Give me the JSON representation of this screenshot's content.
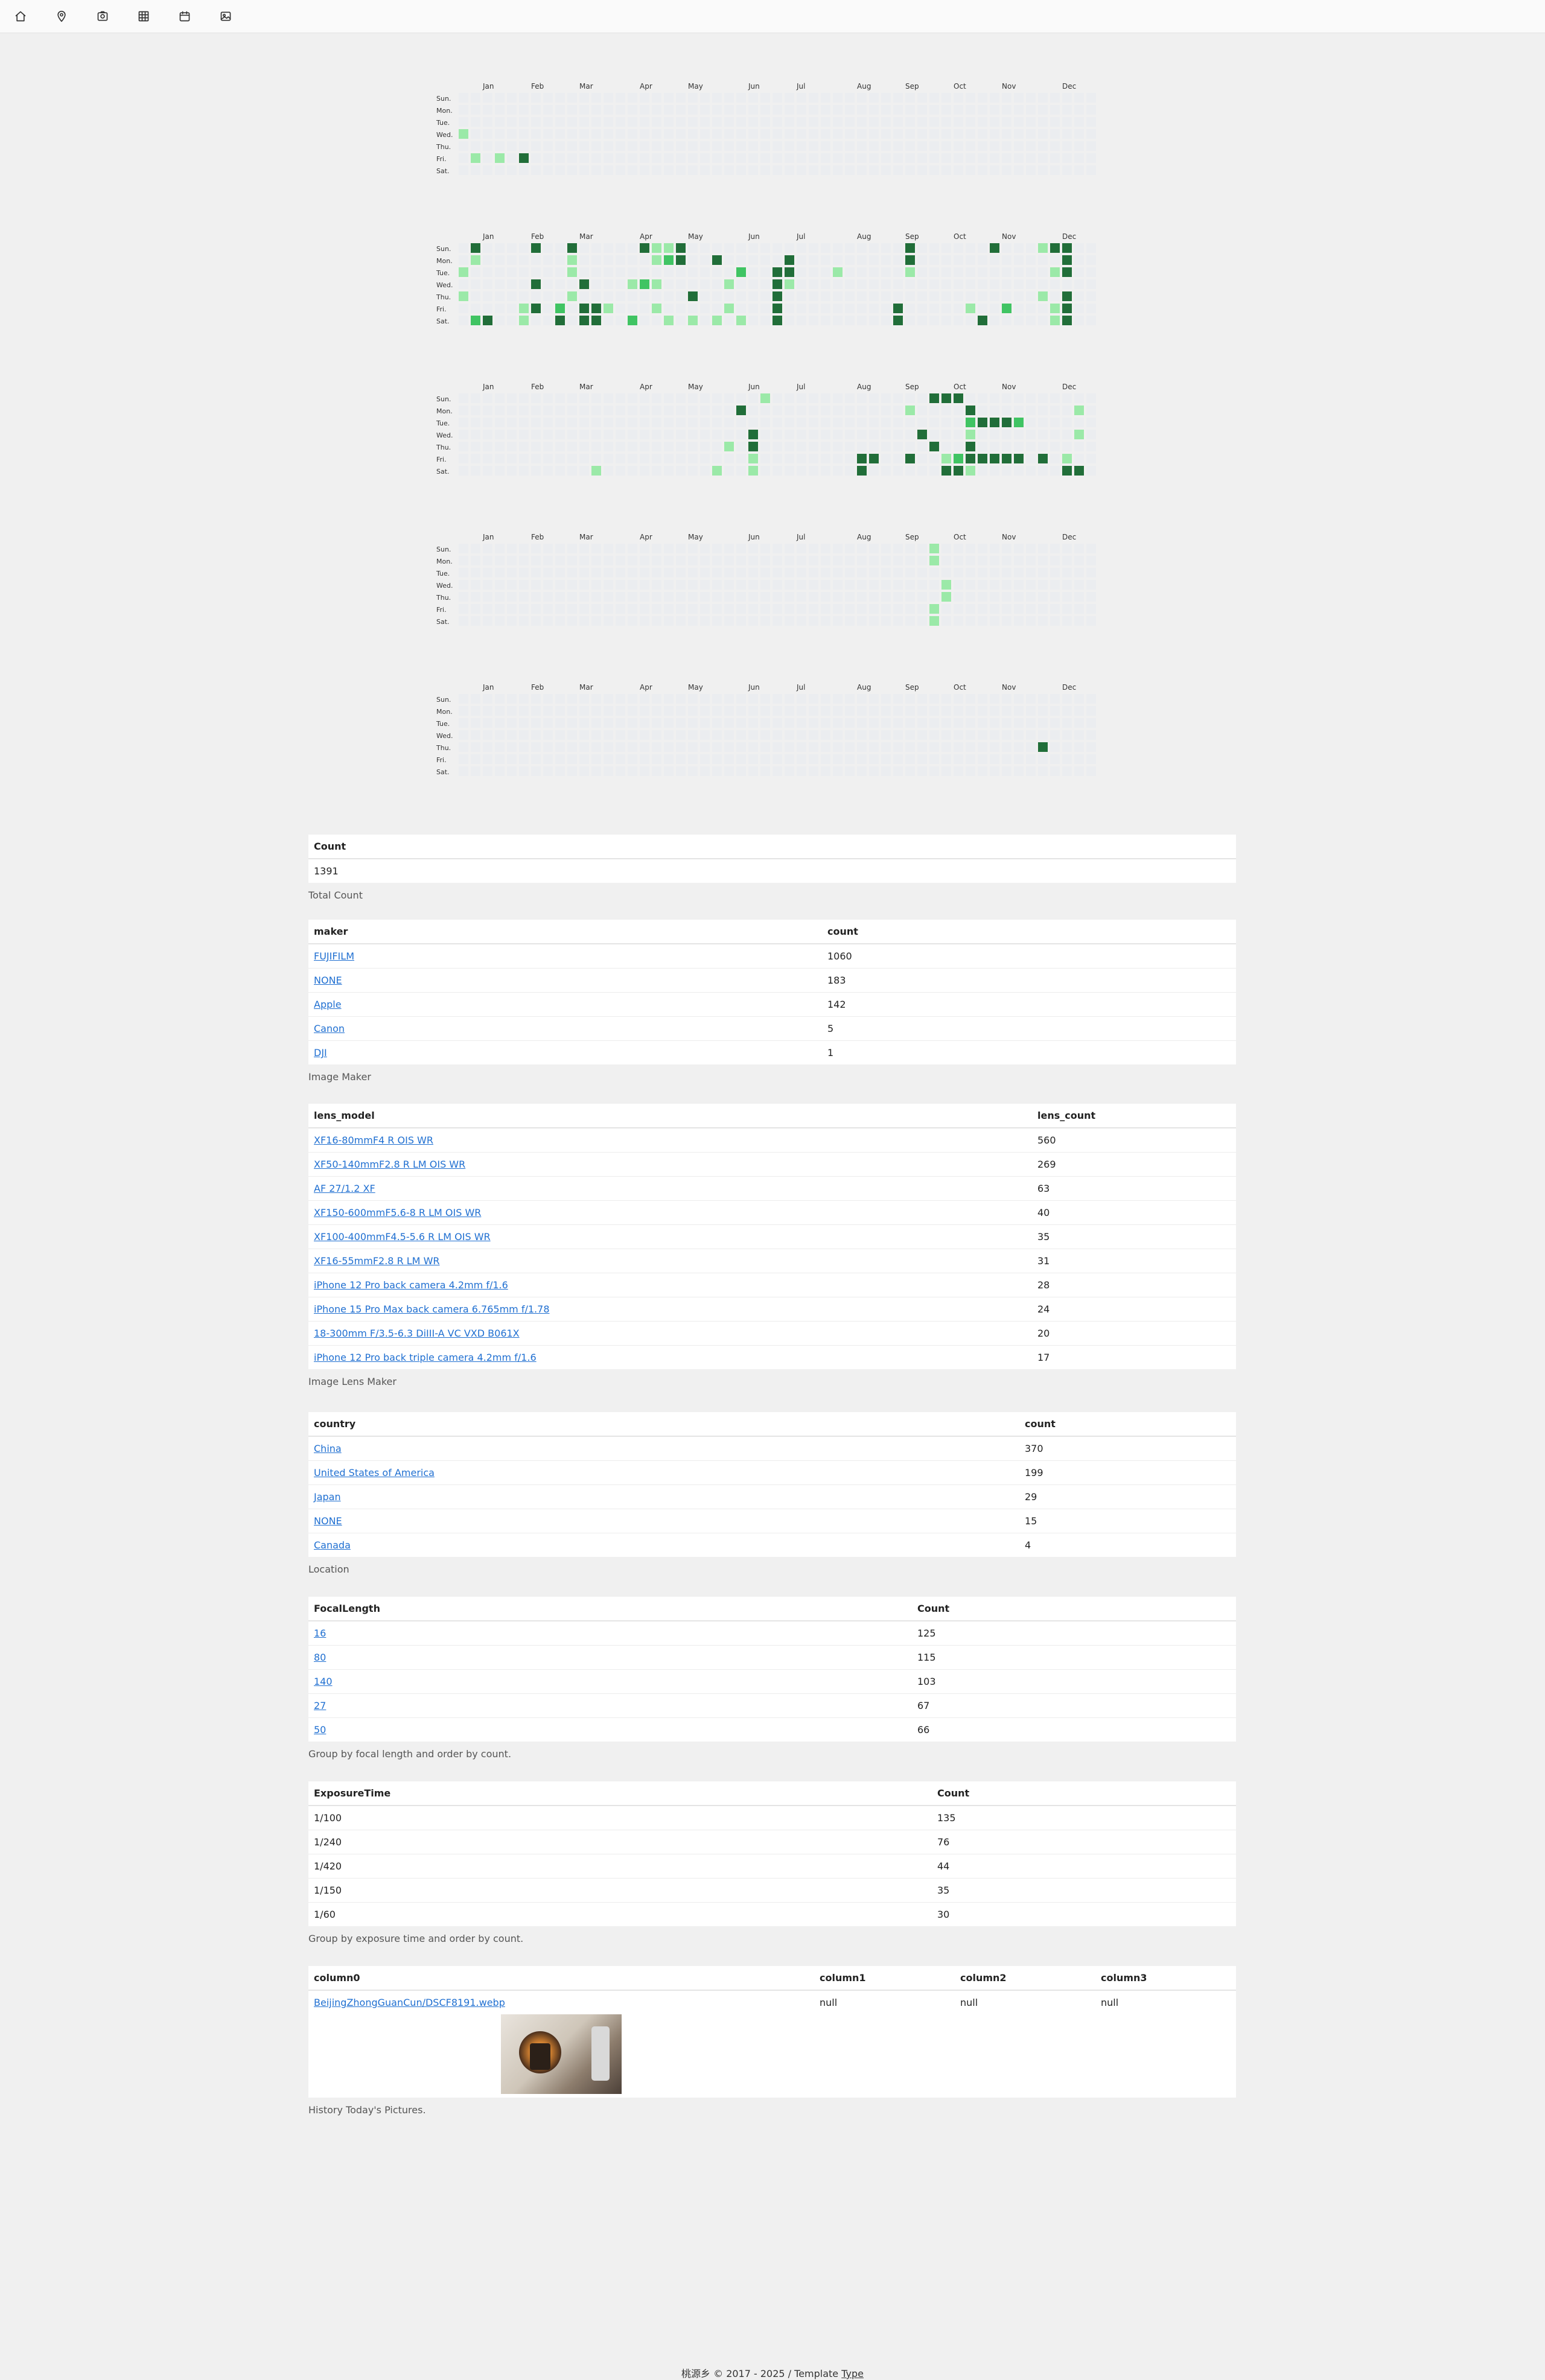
{
  "nav": [
    "home-icon",
    "map-pin-icon",
    "photo-album-icon",
    "grid-icon",
    "calendar-icon",
    "image-icon"
  ],
  "calendar": {
    "months": [
      "Jan",
      "Feb",
      "Mar",
      "Apr",
      "May",
      "Jun",
      "Jul",
      "Aug",
      "Sep",
      "Oct",
      "Nov",
      "Dec"
    ],
    "weekdays": [
      "Sun.",
      "Mon.",
      "Tue.",
      "Wed.",
      "Thu.",
      "Fri.",
      "Sat."
    ],
    "colors": {
      "empty": "#ebedf0",
      "l1": "#9be9a8",
      "l2": "#40c463",
      "l3": "#216e39"
    },
    "heatmaps": [
      {
        "cells": [
          [
            0,
            3,
            1
          ],
          [
            1,
            5,
            1
          ],
          [
            3,
            5,
            1
          ],
          [
            5,
            5,
            3
          ]
        ]
      },
      {
        "cells": [
          [
            1,
            0,
            3
          ],
          [
            1,
            1,
            1
          ],
          [
            0,
            2,
            1
          ],
          [
            0,
            4,
            1
          ],
          [
            1,
            6,
            2
          ],
          [
            2,
            6,
            3
          ],
          [
            6,
            0,
            3
          ],
          [
            6,
            3,
            3
          ],
          [
            5,
            5,
            1
          ],
          [
            5,
            6,
            1
          ],
          [
            6,
            5,
            3
          ],
          [
            9,
            0,
            3
          ],
          [
            9,
            1,
            1
          ],
          [
            9,
            2,
            1
          ],
          [
            10,
            3,
            3
          ],
          [
            9,
            4,
            1
          ],
          [
            8,
            5,
            2
          ],
          [
            8,
            6,
            3
          ],
          [
            10,
            5,
            3
          ],
          [
            11,
            5,
            3
          ],
          [
            10,
            6,
            3
          ],
          [
            11,
            6,
            3
          ],
          [
            12,
            5,
            1
          ],
          [
            14,
            6,
            2
          ],
          [
            14,
            3,
            1
          ],
          [
            15,
            3,
            2
          ],
          [
            16,
            3,
            1
          ],
          [
            15,
            0,
            3
          ],
          [
            16,
            0,
            1
          ],
          [
            17,
            0,
            1
          ],
          [
            18,
            0,
            3
          ],
          [
            16,
            1,
            1
          ],
          [
            17,
            1,
            2
          ],
          [
            18,
            1,
            3
          ],
          [
            16,
            5,
            1
          ],
          [
            17,
            6,
            1
          ],
          [
            19,
            6,
            1
          ],
          [
            19,
            4,
            3
          ],
          [
            21,
            6,
            1
          ],
          [
            21,
            1,
            3
          ],
          [
            22,
            3,
            1
          ],
          [
            22,
            5,
            1
          ],
          [
            23,
            6,
            1
          ],
          [
            23,
            2,
            2
          ],
          [
            26,
            2,
            3
          ],
          [
            26,
            3,
            3
          ],
          [
            26,
            4,
            3
          ],
          [
            26,
            5,
            3
          ],
          [
            26,
            6,
            3
          ],
          [
            27,
            1,
            3
          ],
          [
            27,
            2,
            3
          ],
          [
            27,
            3,
            1
          ],
          [
            31,
            2,
            1
          ],
          [
            36,
            5,
            3
          ],
          [
            36,
            6,
            3
          ],
          [
            37,
            0,
            3
          ],
          [
            37,
            1,
            3
          ],
          [
            37,
            2,
            1
          ],
          [
            42,
            5,
            1
          ],
          [
            43,
            6,
            3
          ],
          [
            44,
            0,
            3
          ],
          [
            45,
            5,
            2
          ],
          [
            48,
            0,
            1
          ],
          [
            48,
            4,
            1
          ],
          [
            49,
            0,
            3
          ],
          [
            49,
            2,
            1
          ],
          [
            49,
            5,
            1
          ],
          [
            49,
            6,
            1
          ],
          [
            50,
            0,
            3
          ],
          [
            50,
            1,
            3
          ],
          [
            50,
            2,
            3
          ],
          [
            50,
            4,
            3
          ],
          [
            50,
            5,
            3
          ],
          [
            50,
            6,
            3
          ]
        ]
      },
      {
        "cells": [
          [
            11,
            6,
            1
          ],
          [
            21,
            6,
            1
          ],
          [
            22,
            4,
            1
          ],
          [
            23,
            1,
            3
          ],
          [
            24,
            3,
            3
          ],
          [
            24,
            4,
            3
          ],
          [
            24,
            5,
            1
          ],
          [
            24,
            6,
            1
          ],
          [
            25,
            0,
            1
          ],
          [
            33,
            5,
            3
          ],
          [
            33,
            6,
            3
          ],
          [
            34,
            5,
            3
          ],
          [
            37,
            1,
            1
          ],
          [
            37,
            5,
            3
          ],
          [
            38,
            3,
            3
          ],
          [
            39,
            0,
            3
          ],
          [
            39,
            4,
            3
          ],
          [
            40,
            5,
            1
          ],
          [
            40,
            6,
            3
          ],
          [
            41,
            5,
            2
          ],
          [
            40,
            0,
            3
          ],
          [
            41,
            0,
            3
          ],
          [
            41,
            6,
            3
          ],
          [
            42,
            1,
            3
          ],
          [
            42,
            2,
            2
          ],
          [
            42,
            3,
            1
          ],
          [
            42,
            4,
            3
          ],
          [
            42,
            5,
            3
          ],
          [
            42,
            6,
            1
          ],
          [
            43,
            5,
            3
          ],
          [
            43,
            2,
            3
          ],
          [
            44,
            5,
            3
          ],
          [
            44,
            2,
            3
          ],
          [
            45,
            5,
            3
          ],
          [
            45,
            2,
            3
          ],
          [
            46,
            2,
            2
          ],
          [
            46,
            5,
            3
          ],
          [
            48,
            5,
            3
          ],
          [
            50,
            5,
            1
          ],
          [
            50,
            6,
            3
          ],
          [
            51,
            6,
            3
          ],
          [
            51,
            1,
            1
          ],
          [
            51,
            3,
            1
          ]
        ]
      },
      {
        "cells": [
          [
            39,
            0,
            1
          ],
          [
            39,
            1,
            1
          ],
          [
            40,
            4,
            1
          ],
          [
            40,
            3,
            1
          ],
          [
            39,
            5,
            1
          ],
          [
            39,
            6,
            1
          ]
        ]
      },
      {
        "cells": [
          [
            48,
            4,
            3
          ]
        ]
      }
    ]
  },
  "tables": {
    "count": {
      "headers": [
        "Count"
      ],
      "rows": [
        [
          "1391"
        ]
      ],
      "caption": "Total Count"
    },
    "maker": {
      "headers": [
        "maker",
        "count"
      ],
      "rows": [
        [
          "FUJIFILM",
          "1060"
        ],
        [
          "NONE",
          "183"
        ],
        [
          "Apple",
          "142"
        ],
        [
          "Canon",
          "5"
        ],
        [
          "DJI",
          "1"
        ]
      ],
      "caption": "Image Maker"
    },
    "lens": {
      "headers": [
        "lens_model",
        "lens_count"
      ],
      "rows": [
        [
          "XF16-80mmF4 R OIS WR",
          "560"
        ],
        [
          "XF50-140mmF2.8 R LM OIS WR",
          "269"
        ],
        [
          "AF 27/1.2 XF",
          "63"
        ],
        [
          "XF150-600mmF5.6-8 R LM OIS WR",
          "40"
        ],
        [
          "XF100-400mmF4.5-5.6 R LM OIS WR",
          "35"
        ],
        [
          "XF16-55mmF2.8 R LM WR",
          "31"
        ],
        [
          "iPhone 12 Pro back camera 4.2mm f/1.6",
          "28"
        ],
        [
          "iPhone 15 Pro Max back camera 6.765mm f/1.78",
          "24"
        ],
        [
          "18-300mm F/3.5-6.3 DiIII-A VC VXD B061X",
          "20"
        ],
        [
          "iPhone 12 Pro back triple camera 4.2mm f/1.6",
          "17"
        ]
      ],
      "caption": "Image Lens Maker"
    },
    "country": {
      "headers": [
        "country",
        "count"
      ],
      "rows": [
        [
          "China",
          "370"
        ],
        [
          "United States of America",
          "199"
        ],
        [
          "Japan",
          "29"
        ],
        [
          "NONE",
          "15"
        ],
        [
          "Canada",
          "4"
        ]
      ],
      "caption": "Location"
    },
    "focal": {
      "headers": [
        "FocalLength",
        "Count"
      ],
      "rows": [
        [
          "16",
          "125"
        ],
        [
          "80",
          "115"
        ],
        [
          "140",
          "103"
        ],
        [
          "27",
          "67"
        ],
        [
          "50",
          "66"
        ]
      ],
      "caption": "Group by focal length and order by count."
    },
    "exposure": {
      "headers": [
        "ExposureTime",
        "Count"
      ],
      "rows": [
        [
          "1/100",
          "135"
        ],
        [
          "1/240",
          "76"
        ],
        [
          "1/420",
          "44"
        ],
        [
          "1/150",
          "35"
        ],
        [
          "1/60",
          "30"
        ]
      ],
      "caption": "Group by exposure time and order by count."
    },
    "history": {
      "headers": [
        "column0",
        "column1",
        "column2",
        "column3"
      ],
      "link": "BeijingZhongGuanCun/DSCF8191.webp",
      "values": [
        "null",
        "null",
        "null"
      ],
      "caption": "History Today's Pictures."
    }
  },
  "footer": {
    "text": "桃源乡 © 2017 - 2025 / Template ",
    "link": "Type"
  }
}
